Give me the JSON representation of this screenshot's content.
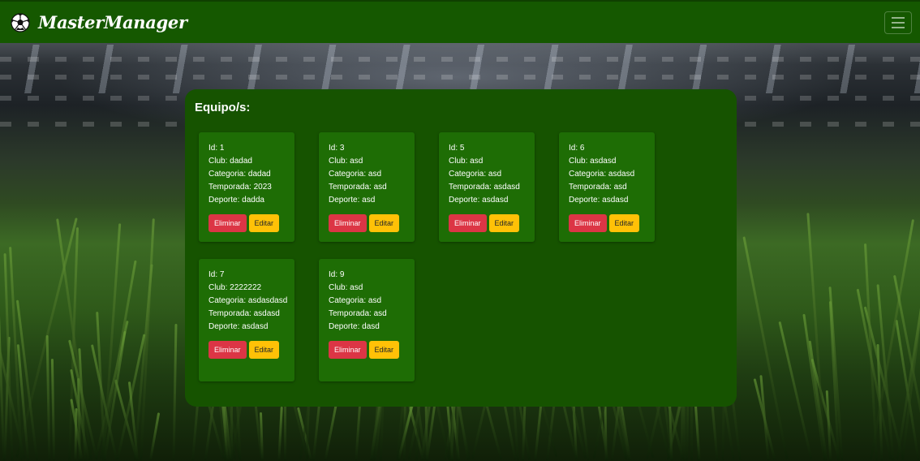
{
  "navbar": {
    "brand": "MasterManager",
    "logo_icon": "soccer-ball-icon",
    "toggler_icon": "hamburger-menu-icon",
    "color": "#155800"
  },
  "panel": {
    "title": "Equipo/s:"
  },
  "labels": {
    "id": "Id:",
    "club": "Club:",
    "categoria": "Categoria:",
    "temporada": "Temporada:",
    "deporte": "Deporte:"
  },
  "buttons": {
    "delete": "Eliminar",
    "edit": "Editar",
    "delete_color": "#dc3545",
    "edit_color": "#ffc107"
  },
  "teams": [
    {
      "id": "1",
      "club": "dadad",
      "categoria": "dadad",
      "temporada": "2023",
      "deporte": "dadda"
    },
    {
      "id": "3",
      "club": "asd",
      "categoria": "asd",
      "temporada": "asd",
      "deporte": "asd"
    },
    {
      "id": "5",
      "club": "asd",
      "categoria": "asd",
      "temporada": "asdasd",
      "deporte": "asdasd"
    },
    {
      "id": "6",
      "club": "asdasd",
      "categoria": "asdasd",
      "temporada": "asd",
      "deporte": "asdasd"
    },
    {
      "id": "7",
      "club": "2222222",
      "categoria": "asdasdasd",
      "temporada": "asdasd",
      "deporte": "asdasd"
    },
    {
      "id": "9",
      "club": "asd",
      "categoria": "asd",
      "temporada": "asd",
      "deporte": "dasd"
    }
  ]
}
